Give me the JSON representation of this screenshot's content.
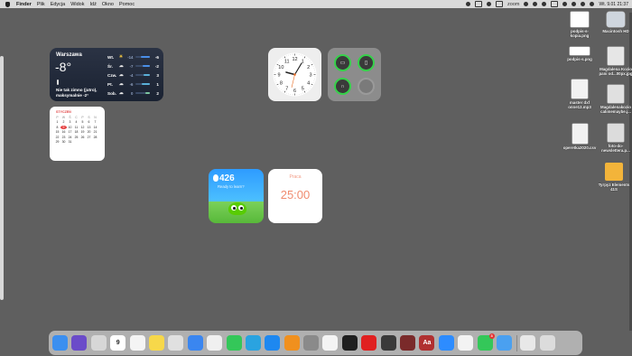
{
  "menubar": {
    "app_name": "Finder",
    "menus": [
      "Plik",
      "Edycja",
      "Widok",
      "Idź",
      "Okno",
      "Pomoc"
    ],
    "zoom_label": "zoom",
    "datetime": "Wt. 9.01 21:37"
  },
  "weather": {
    "city": "Warszawa",
    "temp": "-8°",
    "description": "Nie tak zimno (jutro), maksymalnie -2°",
    "forecast": [
      {
        "day": "Wt.",
        "icon": "☀",
        "low": "-14",
        "high": "-6"
      },
      {
        "day": "Śr.",
        "icon": "☁",
        "low": "-7",
        "high": "-2"
      },
      {
        "day": "Czw.",
        "icon": "☁",
        "low": "-4",
        "high": "3"
      },
      {
        "day": "Pt.",
        "icon": "☁",
        "low": "-6",
        "high": "1"
      },
      {
        "day": "Sob.",
        "icon": "☁",
        "low": "0",
        "high": "2"
      }
    ]
  },
  "calendar": {
    "month": "STYCZEŃ",
    "weekdays": [
      "P",
      "W",
      "Ś",
      "C",
      "P",
      "S",
      "N"
    ],
    "weeks": [
      [
        "1",
        "2",
        "3",
        "4",
        "5",
        "6",
        "7"
      ],
      [
        "8",
        "9",
        "10",
        "11",
        "12",
        "13",
        "14"
      ],
      [
        "15",
        "16",
        "17",
        "18",
        "19",
        "20",
        "21"
      ],
      [
        "22",
        "23",
        "24",
        "25",
        "26",
        "27",
        "28"
      ],
      [
        "29",
        "30",
        "31",
        "",
        "",
        "",
        ""
      ]
    ],
    "today": "9"
  },
  "clock_numbers": [
    "12",
    "1",
    "2",
    "3",
    "4",
    "5",
    "6",
    "7",
    "8",
    "9",
    "10",
    "11"
  ],
  "duolingo": {
    "streak": "426",
    "subtitle": "Ready to learn?"
  },
  "timer": {
    "label": "Praca",
    "time": "25:00"
  },
  "desktop_icons": [
    {
      "name": "podpis-s-\nkopia.png",
      "kind": "image"
    },
    {
      "name": "Macintosh HD",
      "kind": "drive"
    },
    {
      "name": "podpis-s.png",
      "kind": "image"
    },
    {
      "name": "Magdalena Kozio\npani od...00px.jpg",
      "kind": "photo"
    },
    {
      "name": "master dxf\nonne12.mp3",
      "kind": "doc"
    },
    {
      "name": "Magdalenakozio\ncalimemaybe.j...",
      "kind": "photo"
    },
    {
      "name": "operetka2020.csv",
      "kind": "doc"
    },
    {
      "name": "foto-do-\nnewslettera.p...",
      "kind": "photo"
    },
    {
      "name": "Tyrpyz Elements\n41S",
      "kind": "folder"
    }
  ],
  "dock_apps": [
    {
      "name": "finder",
      "color": "#3b8ff0",
      "glyph": ""
    },
    {
      "name": "siri",
      "color": "#6b4cc9",
      "glyph": ""
    },
    {
      "name": "launchpad",
      "color": "#d7d7d7",
      "glyph": ""
    },
    {
      "name": "calendar",
      "color": "#ffffff",
      "glyph": "9"
    },
    {
      "name": "textedit",
      "color": "#f4f4f4",
      "glyph": ""
    },
    {
      "name": "notes",
      "color": "#f7d84a",
      "glyph": ""
    },
    {
      "name": "chrome",
      "color": "#e0e0e0",
      "glyph": ""
    },
    {
      "name": "mail",
      "color": "#3a86f0",
      "glyph": ""
    },
    {
      "name": "photos",
      "color": "#f0f0f0",
      "glyph": ""
    },
    {
      "name": "messages",
      "color": "#34c759",
      "glyph": ""
    },
    {
      "name": "telegram",
      "color": "#2aa3e0",
      "glyph": ""
    },
    {
      "name": "app-store",
      "color": "#1e88f0",
      "glyph": ""
    },
    {
      "name": "books",
      "color": "#f0901e",
      "glyph": ""
    },
    {
      "name": "system-preferences",
      "color": "#8a8a8a",
      "glyph": ""
    },
    {
      "name": "safari",
      "color": "#f4f4f4",
      "glyph": ""
    },
    {
      "name": "activity-monitor",
      "color": "#1f1f1f",
      "glyph": ""
    },
    {
      "name": "acrobat",
      "color": "#e02020",
      "glyph": ""
    },
    {
      "name": "davinci-resolve",
      "color": "#3a3a3a",
      "glyph": ""
    },
    {
      "name": "photo-booth",
      "color": "#7a2a2a",
      "glyph": ""
    },
    {
      "name": "dictionary",
      "color": "#b03030",
      "glyph": "Aa"
    },
    {
      "name": "zoom",
      "color": "#2d8cff",
      "glyph": ""
    },
    {
      "name": "vlc",
      "color": "#f3f3f3",
      "glyph": ""
    },
    {
      "name": "facetime",
      "color": "#34c759",
      "glyph": ""
    },
    {
      "name": "preview",
      "color": "#4aa0f0",
      "glyph": ""
    },
    {
      "name": "downloads-stack",
      "color": "#e8e8e8",
      "glyph": ""
    },
    {
      "name": "trash",
      "color": "#dcdcdc",
      "glyph": ""
    }
  ],
  "dock_badge": "3"
}
